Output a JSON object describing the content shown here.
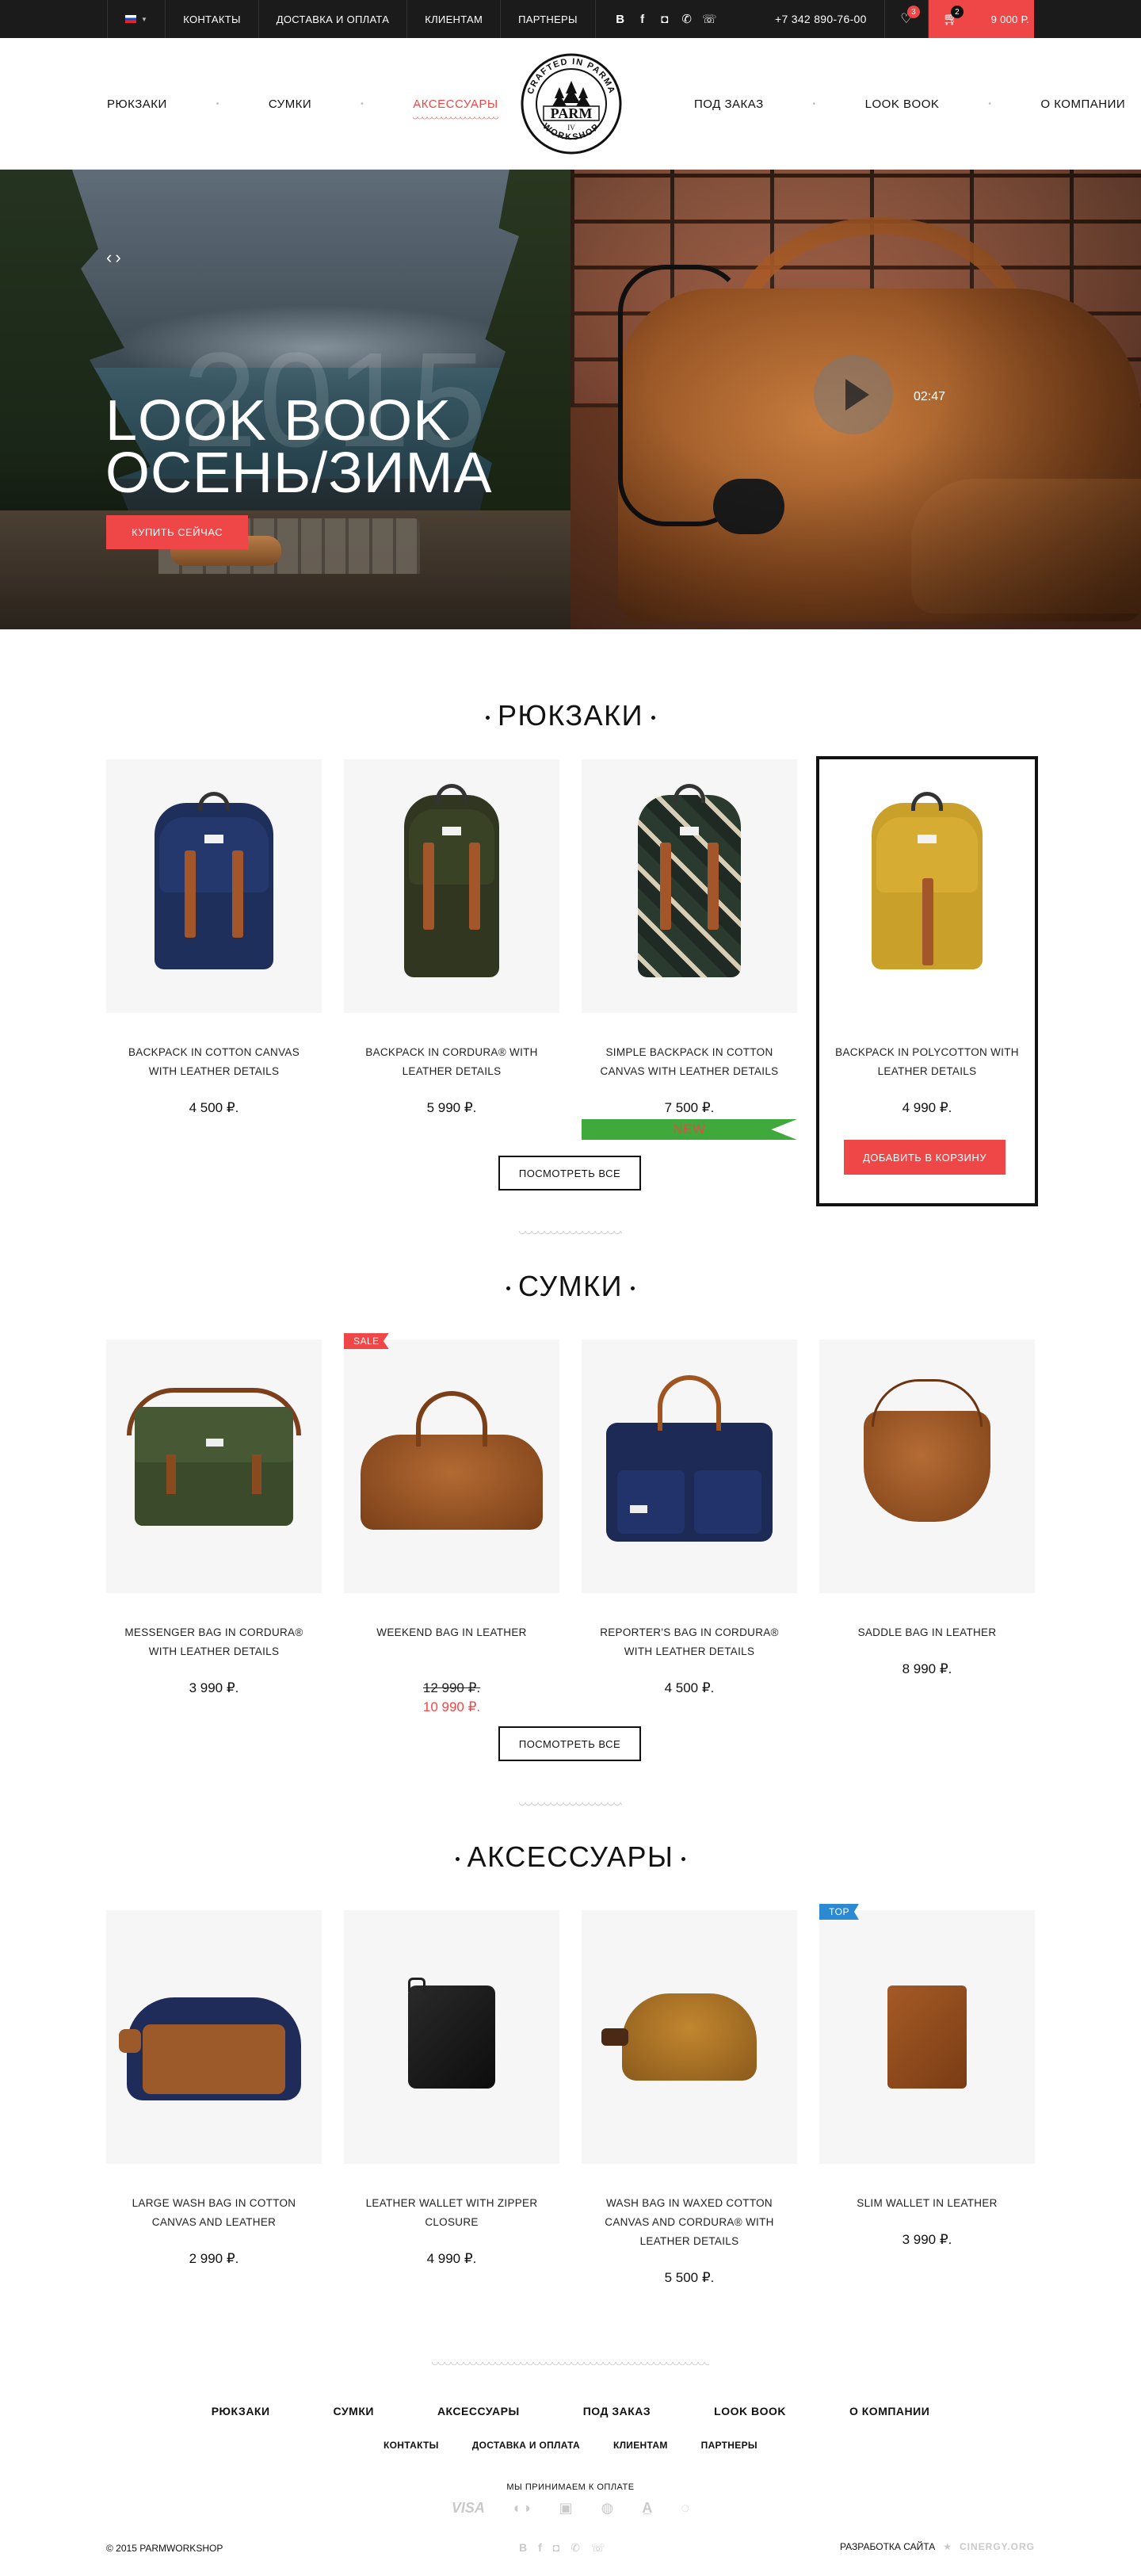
{
  "topbar": {
    "lang": "RU",
    "links": [
      "КОНТАКТЫ",
      "ДОСТАВКА И ОПЛАТА",
      "КЛИЕНТАМ",
      "ПАРТНЕРЫ"
    ],
    "phone": "+7 342 890-76-00",
    "favorites_count": "3",
    "cart_count": "2",
    "cart_total": "9 000 Р."
  },
  "nav": {
    "left": [
      "РЮКЗАКИ",
      "СУМКИ",
      "АКСЕССУАРЫ"
    ],
    "right": [
      "ПОД ЗАКАЗ",
      "LOOK BOOK",
      "О КОМПАНИИ"
    ],
    "active": "АКСЕССУАРЫ"
  },
  "logo": {
    "top_arc": "CRAFTED IN PARMA",
    "main": "PARM",
    "roman": "IV",
    "bottom_arc": "WORKSHOP"
  },
  "hero": {
    "year": "2015",
    "title_line1": "LOOK BOOK",
    "title_line2": "ОСЕНЬ/ЗИМА",
    "button": "КУПИТЬ СЕЙЧАС",
    "video_duration": "02:47"
  },
  "sections": [
    {
      "title": "РЮКЗАКИ",
      "view_all": "ПОСМОТРЕТЬ ВСЕ",
      "products": [
        {
          "name": "BACKPACK IN COTTON CANVAS WITH LEATHER DETAILS",
          "price": "4 500 ₽."
        },
        {
          "name": "BACKPACK IN CORDURA® WITH LEATHER DETAILS",
          "price": "5 990 ₽."
        },
        {
          "name": "SIMPLE BACKPACK IN COTTON CANVAS WITH LEATHER DETAILS",
          "price": "7 500 ₽.",
          "tag": "NEW"
        },
        {
          "name": "BACKPACK IN POLYCOTTON WITH LEATHER DETAILS",
          "price": "4 990 ₽.",
          "add_to_cart": "ДОБАВИТЬ В КОРЗИНУ"
        }
      ]
    },
    {
      "title": "СУМКИ",
      "view_all": "ПОСМОТРЕТЬ ВСЕ",
      "products": [
        {
          "name": "MESSENGER BAG IN CORDURA® WITH LEATHER DETAILS",
          "price": "3 990 ₽."
        },
        {
          "name": "WEEKEND BAG IN LEATHER",
          "old_price": "12 990 ₽.",
          "price": "10 990 ₽.",
          "tag": "SALE"
        },
        {
          "name": "REPORTER'S BAG IN CORDURA® WITH LEATHER DETAILS",
          "price": "4 500 ₽."
        },
        {
          "name": "SADDLE BAG IN LEATHER",
          "price": "8 990 ₽."
        }
      ]
    },
    {
      "title": "АКСЕССУАРЫ",
      "products": [
        {
          "name": "LARGE WASH BAG IN COTTON CANVAS AND LEATHER",
          "price": "2 990 ₽."
        },
        {
          "name": "LEATHER WALLET WITH ZIPPER CLOSURE",
          "price": "4 990 ₽."
        },
        {
          "name": "WASH BAG IN WAXED COTTON CANVAS AND CORDURA® WITH LEATHER DETAILS",
          "price": "5 500 ₽."
        },
        {
          "name": "SLIM WALLET IN LEATHER",
          "price": "3 990 ₽.",
          "tag": "TOP"
        }
      ]
    }
  ],
  "footer": {
    "nav": [
      "РЮКЗАКИ",
      "СУМКИ",
      "АКСЕССУАРЫ",
      "ПОД ЗАКАЗ",
      "LOOK BOOK",
      "О КОМПАНИИ"
    ],
    "nav2": [
      "КОНТАКТЫ",
      "ДОСТАВКА И ОПЛАТА",
      "КЛИЕНТАМ",
      "ПАРТНЕРЫ"
    ],
    "payment_title": "МЫ ПРИНИМАЕМ К ОПЛАТЕ",
    "payment_methods": [
      "VISA",
      "mastercard-icon",
      "wallet-icon",
      "webmoney-icon",
      "alfa-icon",
      "qiwi-icon"
    ],
    "copyright": "© 2015 PARMWORKSHOP",
    "developer_label": "РАЗРАБОТКА САЙТА",
    "developer": "CINERGY.ORG"
  },
  "colors": {
    "accent": "#ef4747",
    "dark": "#1b1b1b",
    "new_tag": "#3fa93b",
    "top_tag": "#2b8ad1"
  }
}
